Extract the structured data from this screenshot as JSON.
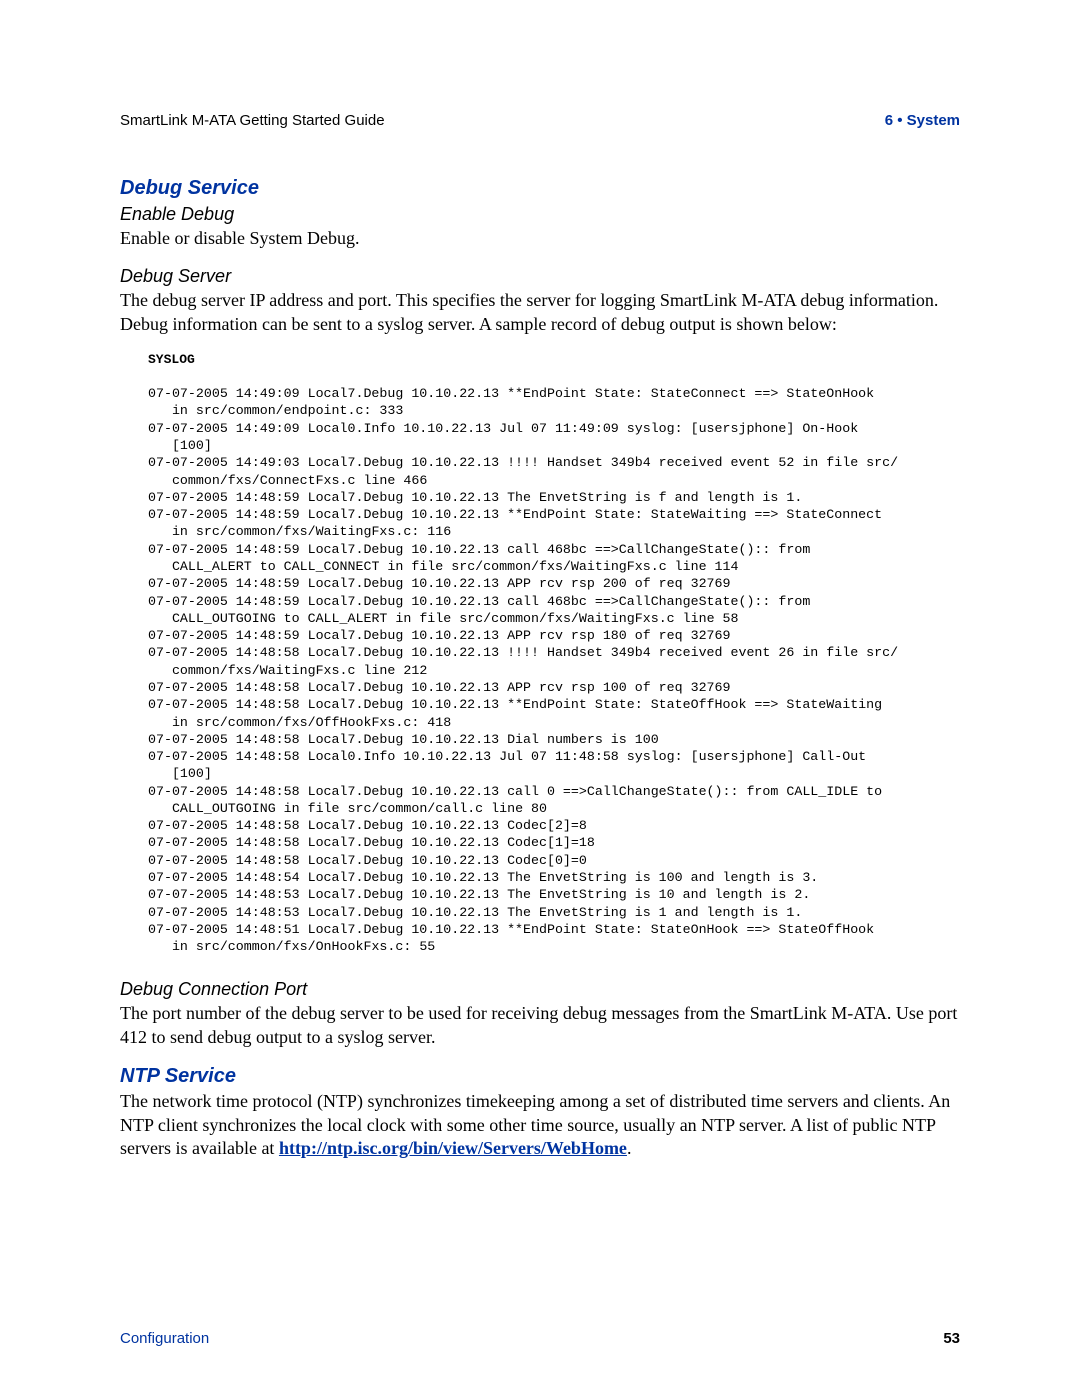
{
  "header": {
    "left": "SmartLink M-ATA Getting Started Guide",
    "right": "6 • System"
  },
  "sections": {
    "debug_service": {
      "title": "Debug Service",
      "enable_debug": {
        "title": "Enable Debug",
        "body": "Enable or disable System Debug."
      },
      "debug_server": {
        "title": "Debug Server",
        "body": "The debug server IP address and port. This specifies the server for logging SmartLink M-ATA debug information. Debug information can be sent to a syslog server. A sample record of debug output is shown below:"
      },
      "syslog_label": "SYSLOG",
      "syslog": "07-07-2005 14:49:09 Local7.Debug 10.10.22.13 **EndPoint State: StateConnect ==> StateOnHook\n   in src/common/endpoint.c: 333\n07-07-2005 14:49:09 Local0.Info 10.10.22.13 Jul 07 11:49:09 syslog: [usersjphone] On-Hook\n   [100]\n07-07-2005 14:49:03 Local7.Debug 10.10.22.13 !!!! Handset 349b4 received event 52 in file src/\n   common/fxs/ConnectFxs.c line 466\n07-07-2005 14:48:59 Local7.Debug 10.10.22.13 The EnvetString is f and length is 1.\n07-07-2005 14:48:59 Local7.Debug 10.10.22.13 **EndPoint State: StateWaiting ==> StateConnect\n   in src/common/fxs/WaitingFxs.c: 116\n07-07-2005 14:48:59 Local7.Debug 10.10.22.13 call 468bc ==>CallChangeState():: from\n   CALL_ALERT to CALL_CONNECT in file src/common/fxs/WaitingFxs.c line 114\n07-07-2005 14:48:59 Local7.Debug 10.10.22.13 APP rcv rsp 200 of req 32769\n07-07-2005 14:48:59 Local7.Debug 10.10.22.13 call 468bc ==>CallChangeState():: from\n   CALL_OUTGOING to CALL_ALERT in file src/common/fxs/WaitingFxs.c line 58\n07-07-2005 14:48:59 Local7.Debug 10.10.22.13 APP rcv rsp 180 of req 32769\n07-07-2005 14:48:58 Local7.Debug 10.10.22.13 !!!! Handset 349b4 received event 26 in file src/\n   common/fxs/WaitingFxs.c line 212\n07-07-2005 14:48:58 Local7.Debug 10.10.22.13 APP rcv rsp 100 of req 32769\n07-07-2005 14:48:58 Local7.Debug 10.10.22.13 **EndPoint State: StateOffHook ==> StateWaiting\n   in src/common/fxs/OffHookFxs.c: 418\n07-07-2005 14:48:58 Local7.Debug 10.10.22.13 Dial numbers is 100\n07-07-2005 14:48:58 Local0.Info 10.10.22.13 Jul 07 11:48:58 syslog: [usersjphone] Call-Out\n   [100]\n07-07-2005 14:48:58 Local7.Debug 10.10.22.13 call 0 ==>CallChangeState():: from CALL_IDLE to\n   CALL_OUTGOING in file src/common/call.c line 80\n07-07-2005 14:48:58 Local7.Debug 10.10.22.13 Codec[2]=8\n07-07-2005 14:48:58 Local7.Debug 10.10.22.13 Codec[1]=18\n07-07-2005 14:48:58 Local7.Debug 10.10.22.13 Codec[0]=0\n07-07-2005 14:48:54 Local7.Debug 10.10.22.13 The EnvetString is 100 and length is 3.\n07-07-2005 14:48:53 Local7.Debug 10.10.22.13 The EnvetString is 10 and length is 2.\n07-07-2005 14:48:53 Local7.Debug 10.10.22.13 The EnvetString is 1 and length is 1.\n07-07-2005 14:48:51 Local7.Debug 10.10.22.13 **EndPoint State: StateOnHook ==> StateOffHook\n   in src/common/fxs/OnHookFxs.c: 55",
      "debug_port": {
        "title": "Debug Connection Port",
        "body": "The port number of the debug server to be used for receiving debug messages from the SmartLink M-ATA. Use port 412 to send debug output to a syslog server."
      }
    },
    "ntp_service": {
      "title": "NTP Service",
      "body_pre": "The network time protocol (NTP) synchronizes timekeeping among a set of distributed time servers and clients. An NTP client synchronizes the local clock with some other time source, usually an NTP server. A list of public NTP servers is available at ",
      "link": "http://ntp.isc.org/bin/view/Servers/WebHome",
      "body_post": "."
    }
  },
  "footer": {
    "left": "Configuration",
    "right": "53"
  }
}
